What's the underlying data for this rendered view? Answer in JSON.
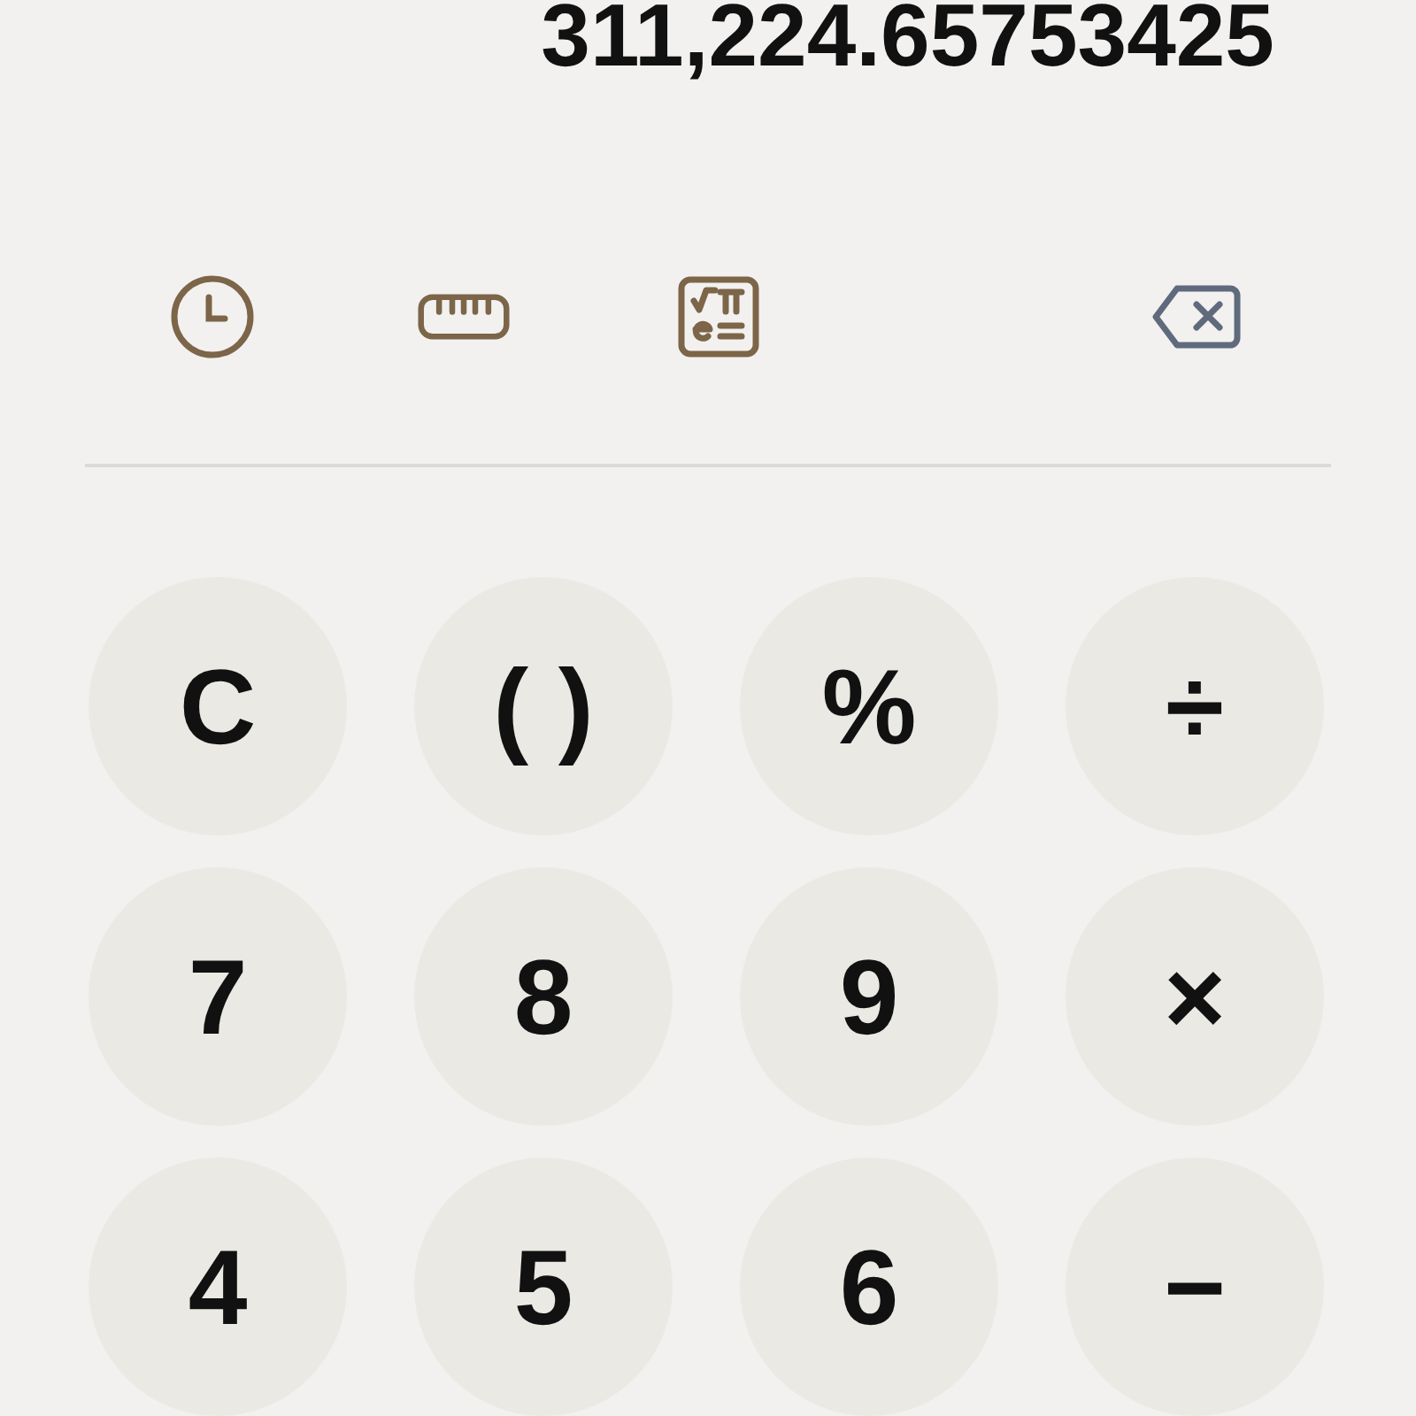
{
  "display": {
    "result": "311,224.65753425"
  },
  "keypad": [
    [
      "C",
      "( )",
      "%",
      "÷"
    ],
    [
      "7",
      "8",
      "9",
      "×"
    ],
    [
      "4",
      "5",
      "6",
      "−"
    ]
  ]
}
